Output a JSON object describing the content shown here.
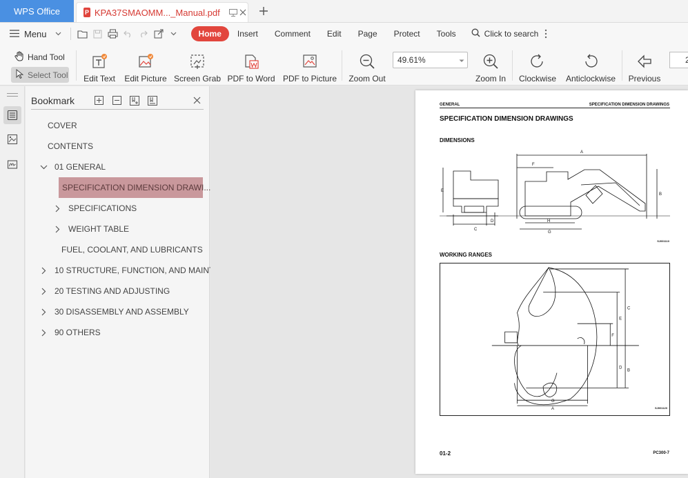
{
  "titlebar": {
    "app_tab": "WPS Office",
    "doc_tab": "KPA37SMAOMM..._Manual.pdf",
    "pdf_badge": "P"
  },
  "menubar": {
    "menu_label": "Menu",
    "tabs": [
      "Home",
      "Insert",
      "Comment",
      "Edit",
      "Page",
      "Protect",
      "Tools"
    ],
    "search_label": "Click to search"
  },
  "toolbar": {
    "hand_tool": "Hand Tool",
    "select_tool": "Select Tool",
    "edit_text": "Edit Text",
    "edit_picture": "Edit Picture",
    "screen_grab": "Screen Grab",
    "pdf_to_word": "PDF to Word",
    "pdf_to_picture": "PDF to Picture",
    "zoom_out": "Zoom Out",
    "zoom_value": "49.61%",
    "zoom_in": "Zoom In",
    "clockwise": "Clockwise",
    "anticlockwise": "Anticlockwise",
    "previous": "Previous",
    "page_input": "2"
  },
  "bookmark": {
    "title": "Bookmark",
    "items": [
      {
        "label": "COVER",
        "expander": "none"
      },
      {
        "label": "CONTENTS",
        "expander": "none"
      },
      {
        "label": "01 GENERAL",
        "expander": "expanded"
      },
      {
        "label": "SPECIFICATION DIMENSION DRAWI...",
        "expander": "none",
        "selected": true
      },
      {
        "label": "SPECIFICATIONS",
        "expander": "collapsed"
      },
      {
        "label": "WEIGHT TABLE",
        "expander": "collapsed"
      },
      {
        "label": "FUEL, COOLANT, AND LUBRICANTS",
        "expander": "none"
      },
      {
        "label": "10 STRUCTURE, FUNCTION, AND MAINT...",
        "expander": "collapsed"
      },
      {
        "label": "20 TESTING AND ADJUSTING",
        "expander": "collapsed"
      },
      {
        "label": "30 DISASSEMBLY AND ASSEMBLY",
        "expander": "collapsed"
      },
      {
        "label": "90 OTHERS",
        "expander": "collapsed"
      }
    ]
  },
  "page": {
    "header_left": "GENERAL",
    "header_right": "SPECIFICATION DIMENSION DRAWINGS",
    "title": "SPECIFICATION DIMENSION DRAWINGS",
    "section_dimensions": "DIMENSIONS",
    "section_working": "WORKING RANGES",
    "fig_code_1": "SJ001110",
    "fig_code_2": "SJ001120",
    "footer_left": "01-2",
    "footer_right": "PC300-7",
    "dim_labels": {
      "a": "A",
      "b": "B",
      "c": "C",
      "d": "D",
      "e": "E",
      "f": "F",
      "g": "G",
      "h": "H"
    }
  },
  "colors": {
    "app_tab_bg": "#4a90e2",
    "home_tab_bg": "#e2463d",
    "pdf_red": "#d63a33",
    "bookmark_selected": "#c9989c"
  }
}
